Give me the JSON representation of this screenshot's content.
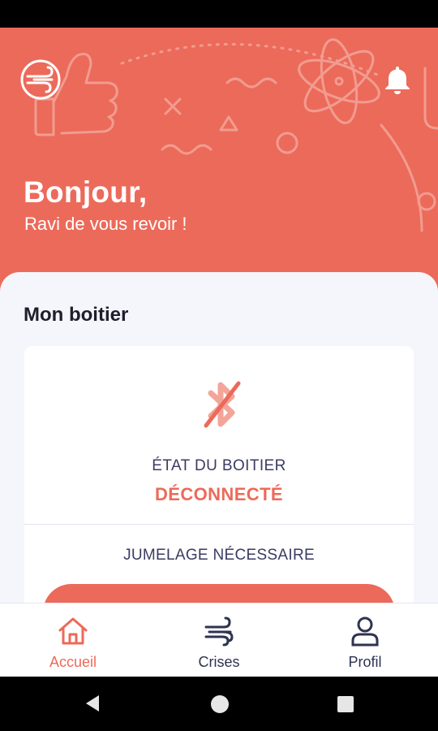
{
  "header": {
    "greeting": "Bonjour,",
    "subtitle": "Ravi de vous revoir !",
    "icons": {
      "logo": "app-logo-icon",
      "notifications": "bell-icon"
    }
  },
  "device_section": {
    "title": "Mon boitier",
    "status_icon": "bluetooth-disabled-icon",
    "state_label": "ÉTAT DU BOITIER",
    "state_value": "DÉCONNECTÉ",
    "pairing_label": "JUMELAGE NÉCESSAIRE"
  },
  "bottom_nav": {
    "items": [
      {
        "label": "Accueil",
        "icon": "home-icon",
        "active": true
      },
      {
        "label": "Crises",
        "icon": "wind-icon",
        "active": false
      },
      {
        "label": "Profil",
        "icon": "user-icon",
        "active": false
      }
    ]
  },
  "system_nav": {
    "icons": [
      "back-icon",
      "home-circle-icon",
      "recents-icon"
    ]
  },
  "colors": {
    "accent": "#EC6A5A",
    "panel_bg": "#F5F6FB",
    "text_dark": "#1E1E2C",
    "text_muted": "#3B3B63"
  }
}
